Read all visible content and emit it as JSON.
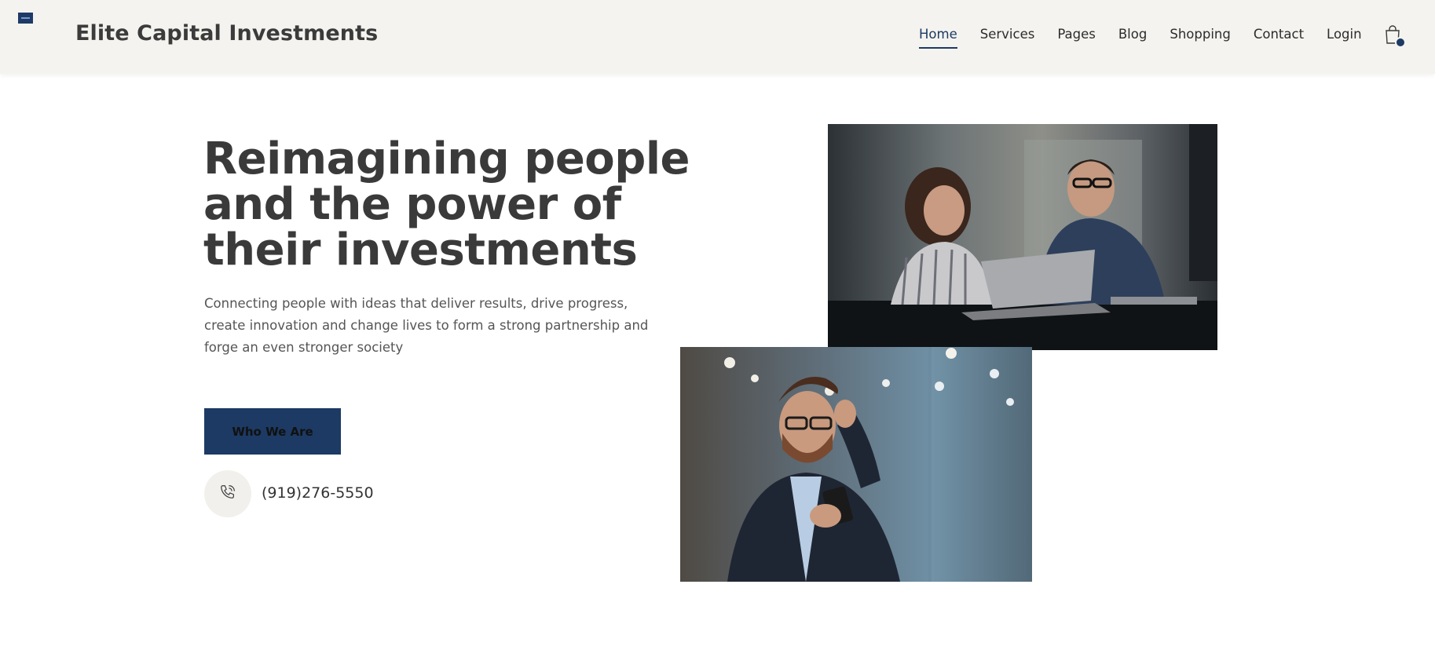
{
  "header": {
    "brand": "Elite Capital Investments",
    "nav": [
      {
        "label": "Home",
        "active": true
      },
      {
        "label": "Services",
        "active": false
      },
      {
        "label": "Pages",
        "active": false
      },
      {
        "label": "Blog",
        "active": false
      },
      {
        "label": "Shopping",
        "active": false
      },
      {
        "label": "Contact",
        "active": false
      },
      {
        "label": "Login",
        "active": false
      }
    ],
    "cart_icon": "shopping-bag-icon"
  },
  "hero": {
    "title_lines": [
      "Reimagining people",
      "and the power of",
      "their investments"
    ],
    "description": "Connecting people with ideas that deliver results, drive progress, create innovation and change lives to form a strong partnership and forge an even stronger society",
    "cta_label": "Who We Are",
    "phone": "(919)276-5550",
    "phone_icon": "phone-icon"
  },
  "images": {
    "photo_1": "two-colleagues-at-laptop-photo",
    "photo_2": "man-with-phone-photo"
  },
  "colors": {
    "accent": "#1c3a63",
    "header_bg": "#f4f3ef",
    "text": "#3a3a3a"
  }
}
